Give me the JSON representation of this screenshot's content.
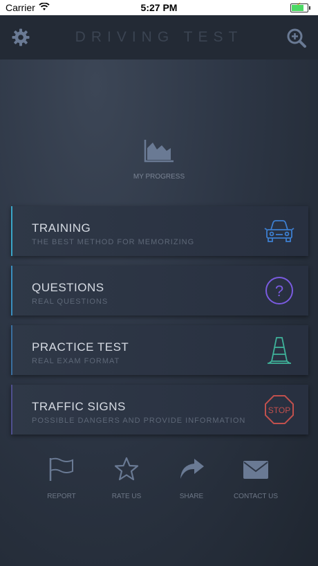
{
  "status_bar": {
    "carrier": "Carrier",
    "time": "5:27 PM"
  },
  "header": {
    "title": "DRIVING TEST"
  },
  "progress": {
    "label": "MY PROGRESS"
  },
  "menu": [
    {
      "title": "TRAINING",
      "subtitle": "THE BEST METHOD FOR MEMORIZING",
      "icon": "car-icon",
      "accent": "#3aa6c8"
    },
    {
      "title": "QUESTIONS",
      "subtitle": "REAL QUESTIONS",
      "icon": "question-icon",
      "accent": "#3a8fbf"
    },
    {
      "title": "PRACTICE TEST",
      "subtitle": "REAL EXAM FORMAT",
      "icon": "traffic-cone-icon",
      "accent": "#3a6f9f"
    },
    {
      "title": "TRAFFIC SIGNS",
      "subtitle": "POSSIBLE DANGERS AND PROVIDE INFORMATION",
      "icon": "stop-sign-icon",
      "accent": "#4f4f8f"
    }
  ],
  "bottom_bar": [
    {
      "label": "REPORT",
      "icon": "flag-icon"
    },
    {
      "label": "RATE US",
      "icon": "star-icon"
    },
    {
      "label": "SHARE",
      "icon": "share-arrow-icon"
    },
    {
      "label": "CONTACT US",
      "icon": "mail-icon"
    }
  ],
  "colors": {
    "car": "#3d7fd0",
    "question": "#7a5be0",
    "cone": "#3fb39a",
    "stop": "#c0504d",
    "icon_gray": "#6a7a94"
  }
}
